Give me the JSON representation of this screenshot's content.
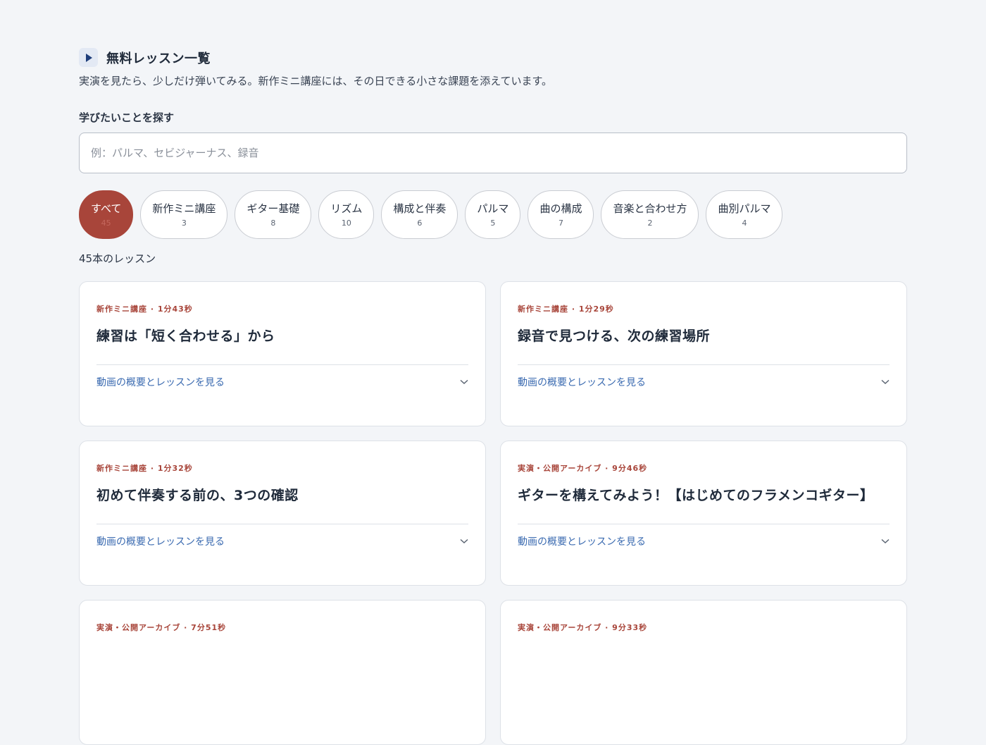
{
  "section": {
    "title": "無料レッスン一覧",
    "description": "実演を見たら、少しだけ弾いてみる。新作ミニ講座には、その日できる小さな課題を添えています。"
  },
  "search": {
    "label": "学びたいことを探す",
    "value": "",
    "placeholder": "例：パルマ、セビジャーナス、録音"
  },
  "filters": [
    {
      "label": "すべて",
      "count": "45",
      "active": true
    },
    {
      "label": "新作ミニ講座",
      "count": "3"
    },
    {
      "label": "ギター基礎",
      "count": "8"
    },
    {
      "label": "リズム",
      "count": "10"
    },
    {
      "label": "構成と伴奏",
      "count": "6"
    },
    {
      "label": "パルマ",
      "count": "5"
    },
    {
      "label": "曲の構成",
      "count": "7"
    },
    {
      "label": "音楽と合わせ方",
      "count": "2"
    },
    {
      "label": "曲別パルマ",
      "count": "4"
    }
  ],
  "result_count": "45本のレッスン",
  "lessons": [
    {
      "meta": "新作ミニ講座 · 1分43秒",
      "title": "練習は「短く合わせる」から",
      "expand_label": "動画の概要とレッスンを見る"
    },
    {
      "meta": "新作ミニ講座 · 1分29秒",
      "title": "録音で見つける、次の練習場所",
      "expand_label": "動画の概要とレッスンを見る"
    },
    {
      "meta": "新作ミニ講座 · 1分32秒",
      "title": "初めて伴奏する前の、3つの確認",
      "expand_label": "動画の概要とレッスンを見る"
    },
    {
      "meta": "実演・公開アーカイブ · 9分46秒",
      "title": "ギターを構えてみよう！【はじめてのフラメンコギター】",
      "expand_label": "動画の概要とレッスンを見る"
    },
    {
      "meta": "実演・公開アーカイブ · 7分51秒",
      "title": "",
      "expand_label": ""
    },
    {
      "meta": "実演・公開アーカイブ · 9分33秒",
      "title": "",
      "expand_label": ""
    }
  ],
  "colors": {
    "accent": "#a8453a",
    "link": "#3a6ab0",
    "background": "#f3f5f8"
  },
  "icons": {
    "section": "play-icon",
    "expand": "chevron-down-icon"
  }
}
